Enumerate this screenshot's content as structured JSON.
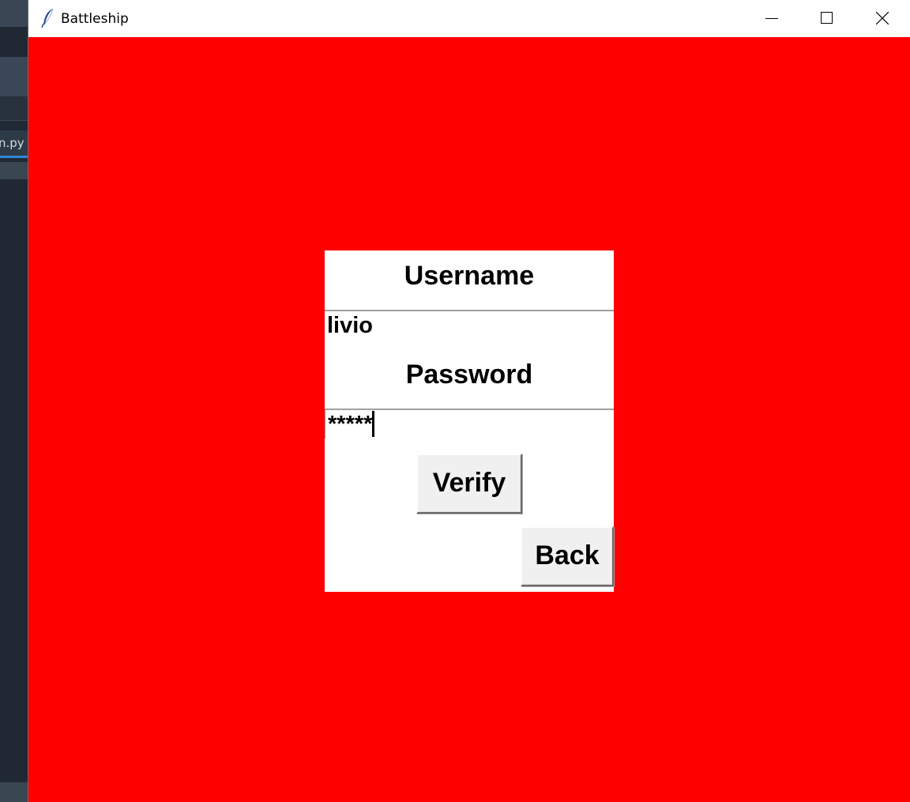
{
  "background_app": {
    "tab_label": "n.py"
  },
  "window": {
    "title": "Battleship",
    "icon": "feather-icon",
    "background_color": "#ff0000"
  },
  "login": {
    "username_label": "Username",
    "username_value": "livio",
    "password_label": "Password",
    "password_value": "*****",
    "verify_label": "Verify",
    "back_label": "Back"
  }
}
